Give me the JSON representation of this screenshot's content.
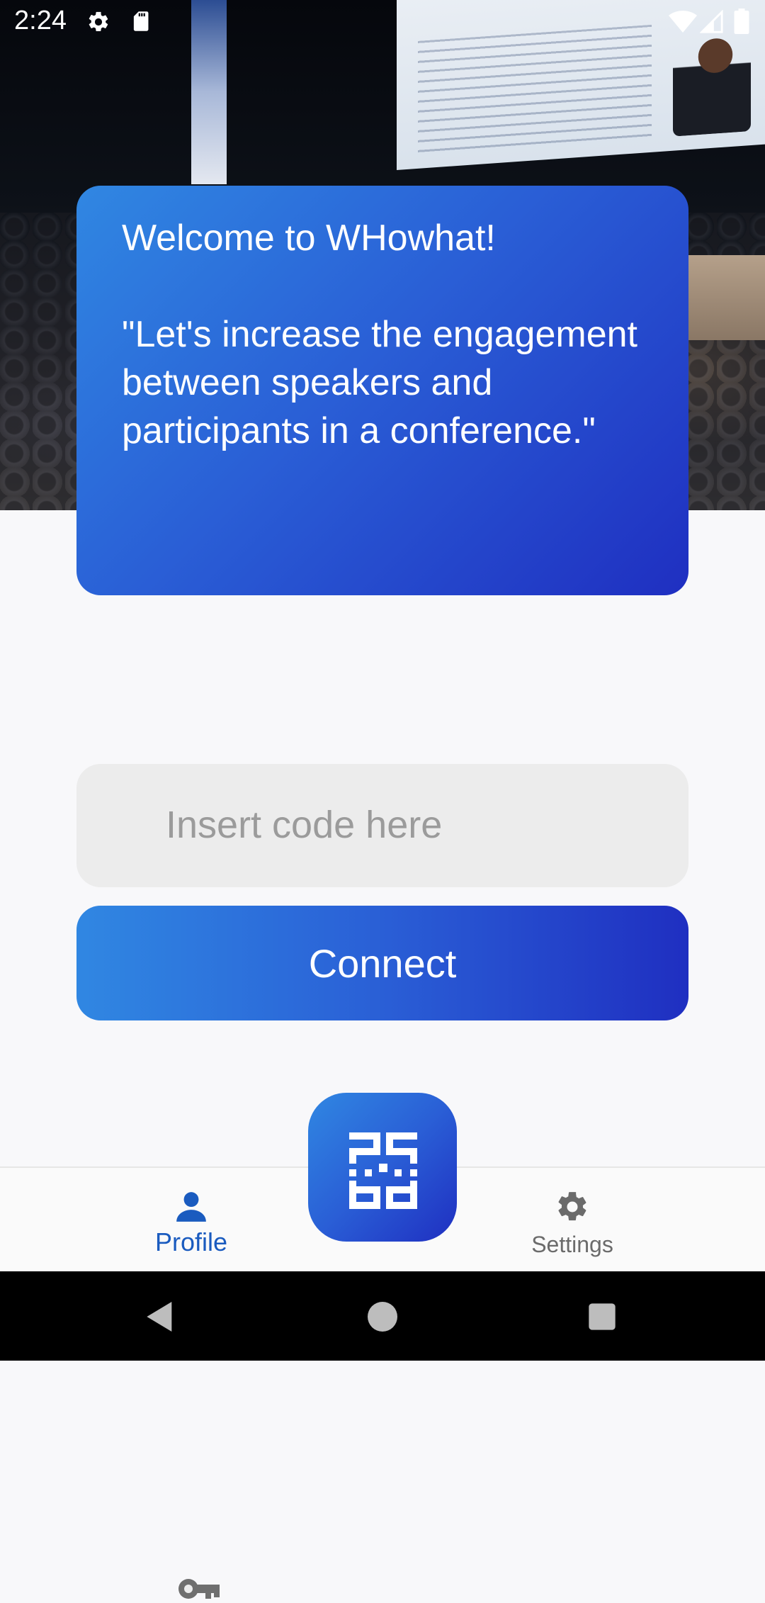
{
  "status_bar": {
    "time": "2:24"
  },
  "welcome_card": {
    "title": "Welcome to WHowhat!",
    "quote": "\"Let's increase the engagement between speakers and participants in a conference.\""
  },
  "code_input": {
    "placeholder": "Insert code here",
    "value": ""
  },
  "connect_button": {
    "label": "Connect"
  },
  "bottom_nav": {
    "items": [
      {
        "label": "Profile",
        "icon": "person-icon",
        "active": true
      },
      {
        "label": "Settings",
        "icon": "gear-icon",
        "active": false
      }
    ],
    "center_button_icon": "qr-code-icon"
  },
  "colors": {
    "accent_start": "#3087e2",
    "accent_end": "#1f2fc1",
    "active_nav": "#1a5bbf",
    "inactive_nav": "#6b6b6b"
  }
}
